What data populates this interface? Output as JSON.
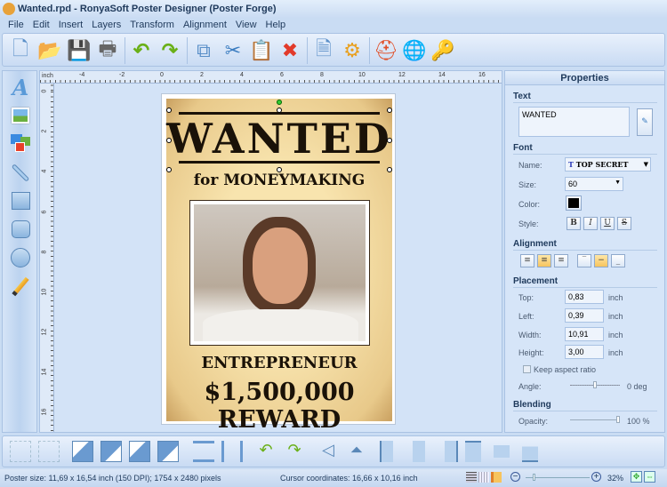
{
  "window": {
    "title": "Wanted.rpd - RonyaSoft Poster Designer (Poster Forge)"
  },
  "menu": [
    "File",
    "Edit",
    "Insert",
    "Layers",
    "Transform",
    "Alignment",
    "View",
    "Help"
  ],
  "toolbar": [
    {
      "name": "new-document",
      "glyph": "🗋"
    },
    {
      "name": "open-folder",
      "glyph": "📂"
    },
    {
      "name": "save",
      "glyph": "💾"
    },
    {
      "name": "print",
      "glyph": "🖶"
    },
    {
      "name": "undo",
      "glyph": "↶"
    },
    {
      "name": "redo",
      "glyph": "↷"
    },
    {
      "name": "copy",
      "glyph": "⧉"
    },
    {
      "name": "cut",
      "glyph": "✂"
    },
    {
      "name": "paste",
      "glyph": "📋"
    },
    {
      "name": "delete",
      "glyph": "✖"
    },
    {
      "name": "page-settings",
      "glyph": "🗎"
    },
    {
      "name": "settings",
      "glyph": "⚙"
    },
    {
      "name": "help",
      "glyph": "⛑"
    },
    {
      "name": "web",
      "glyph": "🌐"
    },
    {
      "name": "key",
      "glyph": "🔑"
    }
  ],
  "ruler": {
    "unit": "inch",
    "h_ticks": [
      "-4",
      "-2",
      "0",
      "2",
      "4",
      "6",
      "8",
      "10",
      "12",
      "14",
      "16"
    ],
    "v_ticks": [
      "0",
      "2",
      "4",
      "6",
      "8",
      "10",
      "12",
      "14",
      "16"
    ]
  },
  "poster": {
    "title": "WANTED",
    "subtitle": "for MONEYMAKING",
    "occupation": "ENTREPRENEUR",
    "reward": "$1,500,000 REWARD"
  },
  "properties": {
    "header": "Properties",
    "text": {
      "section": "Text",
      "value": "WANTED"
    },
    "font": {
      "section": "Font",
      "name_label": "Name:",
      "name": "TOP SECRET",
      "size_label": "Size:",
      "size": "60",
      "color_label": "Color:",
      "color": "#000000",
      "style_label": "Style:",
      "styles": [
        "B",
        "I",
        "U",
        "S"
      ]
    },
    "alignment": {
      "section": "Alignment",
      "horizontal_selected": "center",
      "vertical_selected": "middle"
    },
    "placement": {
      "section": "Placement",
      "top_label": "Top:",
      "top": "0,83",
      "left_label": "Left:",
      "left": "0,39",
      "width_label": "Width:",
      "width": "10,91",
      "height_label": "Height:",
      "height": "3,00",
      "unit": "inch",
      "keep_aspect": "Keep aspect ratio",
      "keep_aspect_checked": false,
      "angle_label": "Angle:",
      "angle": "0 deg",
      "angle_value": 0
    },
    "blending": {
      "section": "Blending",
      "opacity_label": "Opacity:",
      "opacity": "100 %",
      "opacity_value": 100
    }
  },
  "status": {
    "poster_size": "Poster size: 11,69 x 16,54 inch (150 DPI); 1754 x 2480 pixels",
    "cursor": "Cursor coordinates: 16,66 x 10,16 inch",
    "zoom": "32%"
  }
}
